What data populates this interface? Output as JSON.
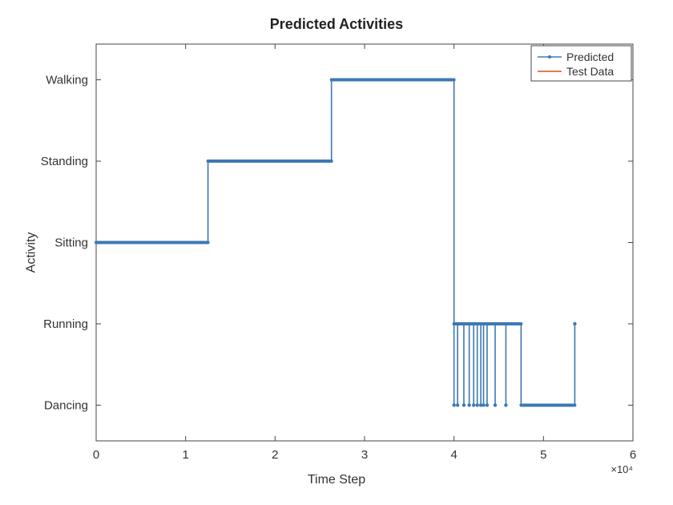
{
  "chart_data": {
    "type": "line",
    "title": "Predicted Activities",
    "xlabel": "Time Step",
    "ylabel": "Activity",
    "x_exponent_label": "×10⁴",
    "x_ticks": [
      0,
      1,
      2,
      3,
      4,
      5,
      6
    ],
    "y_categories": [
      "Dancing",
      "Running",
      "Sitting",
      "Standing",
      "Walking"
    ],
    "xlim": [
      0,
      60000
    ],
    "legend": {
      "position": "northeast",
      "entries": [
        "Predicted",
        "Test Data"
      ]
    },
    "series": [
      {
        "name": "Test Data",
        "segments": [
          {
            "x0": 0,
            "x1": 12500,
            "activity": "Sitting"
          },
          {
            "x0": 12500,
            "x1": 26300,
            "activity": "Standing"
          },
          {
            "x0": 26300,
            "x1": 40000,
            "activity": "Walking"
          },
          {
            "x0": 40000,
            "x1": 47500,
            "activity": "Running"
          },
          {
            "x0": 47500,
            "x1": 53500,
            "activity": "Dancing"
          }
        ]
      },
      {
        "name": "Predicted",
        "note": "Follows Test Data closely for Sitting/Standing/Walking; during Running (x≈40000–47500) predictions oscillate between Running and Dancing; at x≈53500 a single spike from Dancing to Running.",
        "segments": [
          {
            "x0": 0,
            "x1": 12500,
            "activity": "Sitting"
          },
          {
            "x0": 12500,
            "x1": 26300,
            "activity": "Standing"
          },
          {
            "x0": 26300,
            "x1": 40000,
            "activity": "Walking"
          },
          {
            "x0": 40000,
            "x1": 47500,
            "activity": "Running",
            "spikes_to": "Dancing",
            "spike_x": [
              40000,
              40400,
              41100,
              41700,
              42200,
              42600,
              43000,
              43300,
              43700,
              44600,
              45800
            ]
          },
          {
            "x0": 47500,
            "x1": 53500,
            "activity": "Dancing",
            "spikes_to": "Running",
            "spike_x": [
              53500
            ]
          }
        ]
      }
    ]
  }
}
